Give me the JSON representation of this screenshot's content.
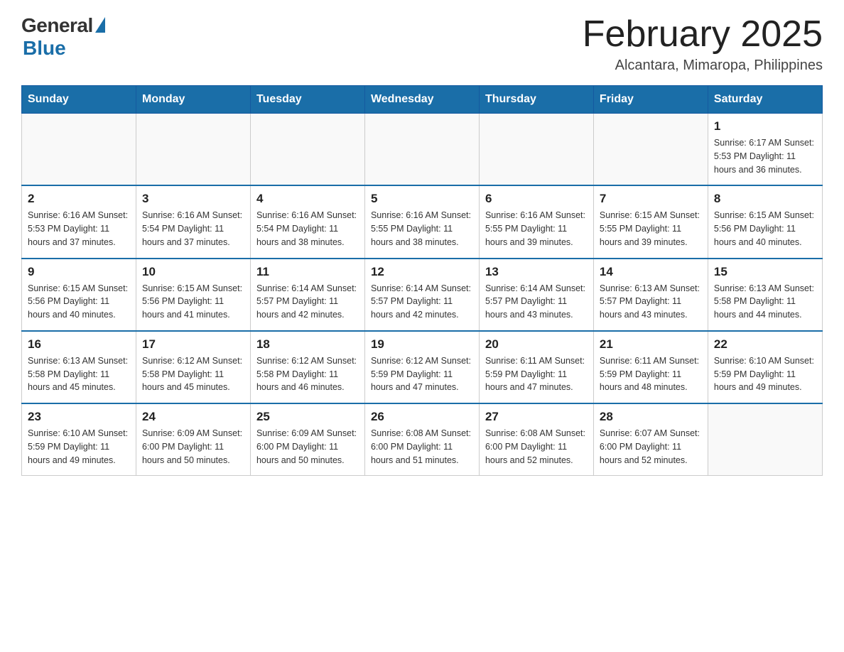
{
  "header": {
    "logo": {
      "general": "General",
      "blue": "Blue"
    },
    "title": "February 2025",
    "subtitle": "Alcantara, Mimaropa, Philippines"
  },
  "weekdays": [
    "Sunday",
    "Monday",
    "Tuesday",
    "Wednesday",
    "Thursday",
    "Friday",
    "Saturday"
  ],
  "weeks": [
    [
      {
        "day": "",
        "info": ""
      },
      {
        "day": "",
        "info": ""
      },
      {
        "day": "",
        "info": ""
      },
      {
        "day": "",
        "info": ""
      },
      {
        "day": "",
        "info": ""
      },
      {
        "day": "",
        "info": ""
      },
      {
        "day": "1",
        "info": "Sunrise: 6:17 AM\nSunset: 5:53 PM\nDaylight: 11 hours and 36 minutes."
      }
    ],
    [
      {
        "day": "2",
        "info": "Sunrise: 6:16 AM\nSunset: 5:53 PM\nDaylight: 11 hours and 37 minutes."
      },
      {
        "day": "3",
        "info": "Sunrise: 6:16 AM\nSunset: 5:54 PM\nDaylight: 11 hours and 37 minutes."
      },
      {
        "day": "4",
        "info": "Sunrise: 6:16 AM\nSunset: 5:54 PM\nDaylight: 11 hours and 38 minutes."
      },
      {
        "day": "5",
        "info": "Sunrise: 6:16 AM\nSunset: 5:55 PM\nDaylight: 11 hours and 38 minutes."
      },
      {
        "day": "6",
        "info": "Sunrise: 6:16 AM\nSunset: 5:55 PM\nDaylight: 11 hours and 39 minutes."
      },
      {
        "day": "7",
        "info": "Sunrise: 6:15 AM\nSunset: 5:55 PM\nDaylight: 11 hours and 39 minutes."
      },
      {
        "day": "8",
        "info": "Sunrise: 6:15 AM\nSunset: 5:56 PM\nDaylight: 11 hours and 40 minutes."
      }
    ],
    [
      {
        "day": "9",
        "info": "Sunrise: 6:15 AM\nSunset: 5:56 PM\nDaylight: 11 hours and 40 minutes."
      },
      {
        "day": "10",
        "info": "Sunrise: 6:15 AM\nSunset: 5:56 PM\nDaylight: 11 hours and 41 minutes."
      },
      {
        "day": "11",
        "info": "Sunrise: 6:14 AM\nSunset: 5:57 PM\nDaylight: 11 hours and 42 minutes."
      },
      {
        "day": "12",
        "info": "Sunrise: 6:14 AM\nSunset: 5:57 PM\nDaylight: 11 hours and 42 minutes."
      },
      {
        "day": "13",
        "info": "Sunrise: 6:14 AM\nSunset: 5:57 PM\nDaylight: 11 hours and 43 minutes."
      },
      {
        "day": "14",
        "info": "Sunrise: 6:13 AM\nSunset: 5:57 PM\nDaylight: 11 hours and 43 minutes."
      },
      {
        "day": "15",
        "info": "Sunrise: 6:13 AM\nSunset: 5:58 PM\nDaylight: 11 hours and 44 minutes."
      }
    ],
    [
      {
        "day": "16",
        "info": "Sunrise: 6:13 AM\nSunset: 5:58 PM\nDaylight: 11 hours and 45 minutes."
      },
      {
        "day": "17",
        "info": "Sunrise: 6:12 AM\nSunset: 5:58 PM\nDaylight: 11 hours and 45 minutes."
      },
      {
        "day": "18",
        "info": "Sunrise: 6:12 AM\nSunset: 5:58 PM\nDaylight: 11 hours and 46 minutes."
      },
      {
        "day": "19",
        "info": "Sunrise: 6:12 AM\nSunset: 5:59 PM\nDaylight: 11 hours and 47 minutes."
      },
      {
        "day": "20",
        "info": "Sunrise: 6:11 AM\nSunset: 5:59 PM\nDaylight: 11 hours and 47 minutes."
      },
      {
        "day": "21",
        "info": "Sunrise: 6:11 AM\nSunset: 5:59 PM\nDaylight: 11 hours and 48 minutes."
      },
      {
        "day": "22",
        "info": "Sunrise: 6:10 AM\nSunset: 5:59 PM\nDaylight: 11 hours and 49 minutes."
      }
    ],
    [
      {
        "day": "23",
        "info": "Sunrise: 6:10 AM\nSunset: 5:59 PM\nDaylight: 11 hours and 49 minutes."
      },
      {
        "day": "24",
        "info": "Sunrise: 6:09 AM\nSunset: 6:00 PM\nDaylight: 11 hours and 50 minutes."
      },
      {
        "day": "25",
        "info": "Sunrise: 6:09 AM\nSunset: 6:00 PM\nDaylight: 11 hours and 50 minutes."
      },
      {
        "day": "26",
        "info": "Sunrise: 6:08 AM\nSunset: 6:00 PM\nDaylight: 11 hours and 51 minutes."
      },
      {
        "day": "27",
        "info": "Sunrise: 6:08 AM\nSunset: 6:00 PM\nDaylight: 11 hours and 52 minutes."
      },
      {
        "day": "28",
        "info": "Sunrise: 6:07 AM\nSunset: 6:00 PM\nDaylight: 11 hours and 52 minutes."
      },
      {
        "day": "",
        "info": ""
      }
    ]
  ]
}
